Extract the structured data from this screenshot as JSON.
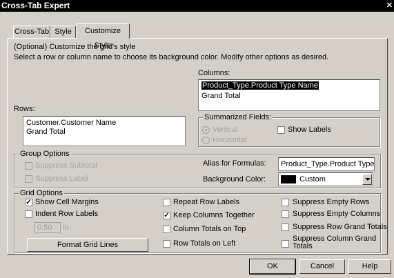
{
  "window": {
    "title": "Cross-Tab Expert",
    "close_glyph": "✕"
  },
  "tabs": [
    {
      "label": "Cross-Tab"
    },
    {
      "label": "Style"
    },
    {
      "label": "Customize Style",
      "active": true
    }
  ],
  "intro": {
    "line1": "(Optional) Customize the grid's style",
    "line2": "Select a row or column name to choose its background color.  Modify other options as desired."
  },
  "columns": {
    "label": "Columns:",
    "items": [
      "Product_Type.Product Type Name",
      "Grand Total"
    ],
    "selected_index": 0
  },
  "rows": {
    "label": "Rows:",
    "items": [
      "Customer.Customer Name",
      "Grand Total"
    ]
  },
  "summarized": {
    "title": "Summarized Fields:",
    "vertical": "Vertical",
    "horizontal": "Horizontal",
    "show_labels": "Show Labels",
    "orientation_selected": "Vertical"
  },
  "group_options": {
    "title": "Group Options",
    "suppress_subtotal": "Suppress Subtotal",
    "suppress_label": "Suppress Label"
  },
  "alias": {
    "label": "Alias for Formulas:",
    "value": "Product_Type.Product Type Na"
  },
  "background": {
    "label": "Background Color:",
    "value": "Custom",
    "color": "#000000"
  },
  "grid_options": {
    "title": "Grid  Options",
    "show_cell_margins": {
      "label": "Show Cell Margins",
      "checked": true
    },
    "indent_row_labels": {
      "label": "Indent Row Labels",
      "checked": false
    },
    "indent_value": "0.50",
    "indent_unit": "in",
    "format_grid_lines": "Format Grid Lines",
    "repeat_row_labels": {
      "label": "Repeat Row Labels",
      "checked": false
    },
    "keep_columns_together": {
      "label": "Keep Columns Together",
      "checked": true
    },
    "column_totals_on_top": {
      "label": "Column Totals on Top",
      "checked": false
    },
    "row_totals_on_left": {
      "label": "Row Totals on Left",
      "checked": false
    },
    "suppress_empty_rows": {
      "label": "Suppress Empty Rows",
      "checked": false
    },
    "suppress_empty_columns": {
      "label": "Suppress Empty Columns",
      "checked": false
    },
    "suppress_row_grand_totals": {
      "label": "Suppress Row Grand Totals",
      "checked": false
    },
    "suppress_column_grand_totals": {
      "label_line1": "Suppress Column Grand",
      "label_line2": "Totals",
      "checked": false
    }
  },
  "buttons": {
    "ok": "OK",
    "cancel": "Cancel",
    "help": "Help"
  },
  "check_glyph": "✓"
}
